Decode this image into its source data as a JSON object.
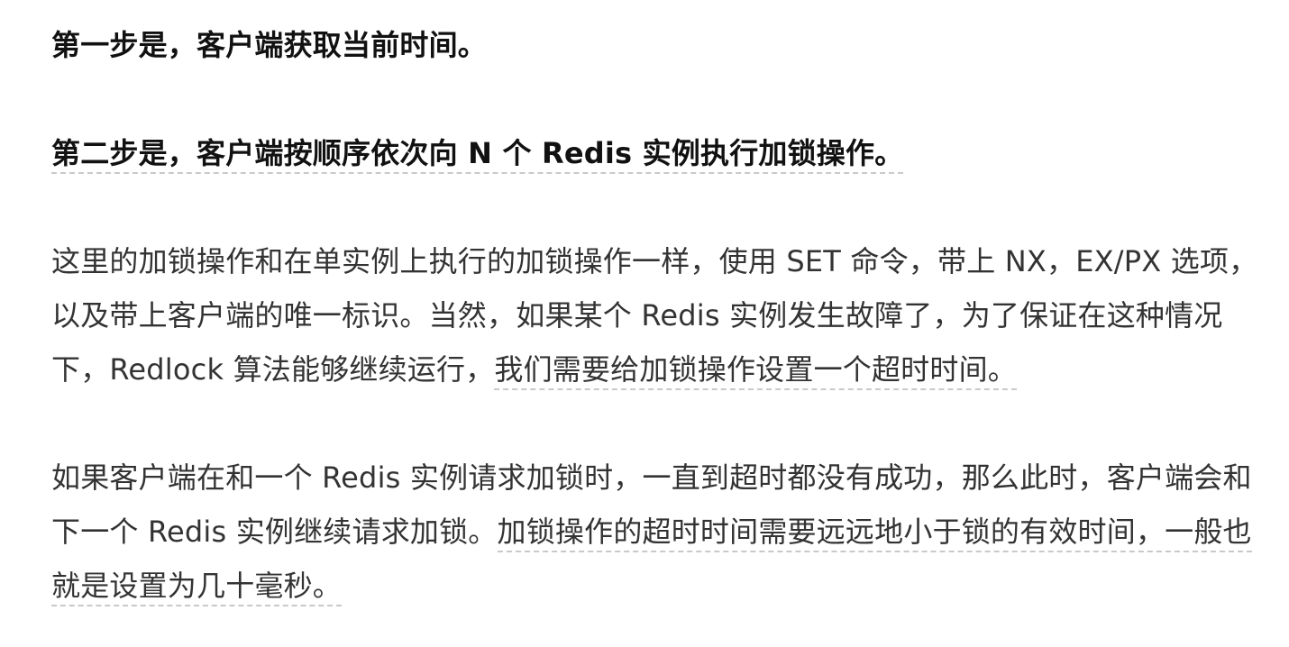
{
  "article": {
    "step1": "第一步是，客户端获取当前时间。",
    "step2": "第二步是，客户端按顺序依次向 N 个 Redis 实例执行加锁操作。",
    "para3": {
      "text": "这里的加锁操作和在单实例上执行的加锁操作一样，使用 SET 命令，带上 NX，EX/PX 选项，以及带上客户端的唯一标识。当然，如果某个 Redis 实例发生故障了，为了保证在这种情况下，Redlock 算法能够继续运行，",
      "highlight": "我们需要给加锁操作设置一个超时时间。"
    },
    "para4": {
      "text": "如果客户端在和一个 Redis 实例请求加锁时，一直到超时都没有成功，那么此时，客户端会和下一个 Redis 实例继续请求加锁。",
      "highlight": "加锁操作的超时时间需要远远地小于锁的有效时间，一般也就是设置为几十毫秒。"
    }
  }
}
